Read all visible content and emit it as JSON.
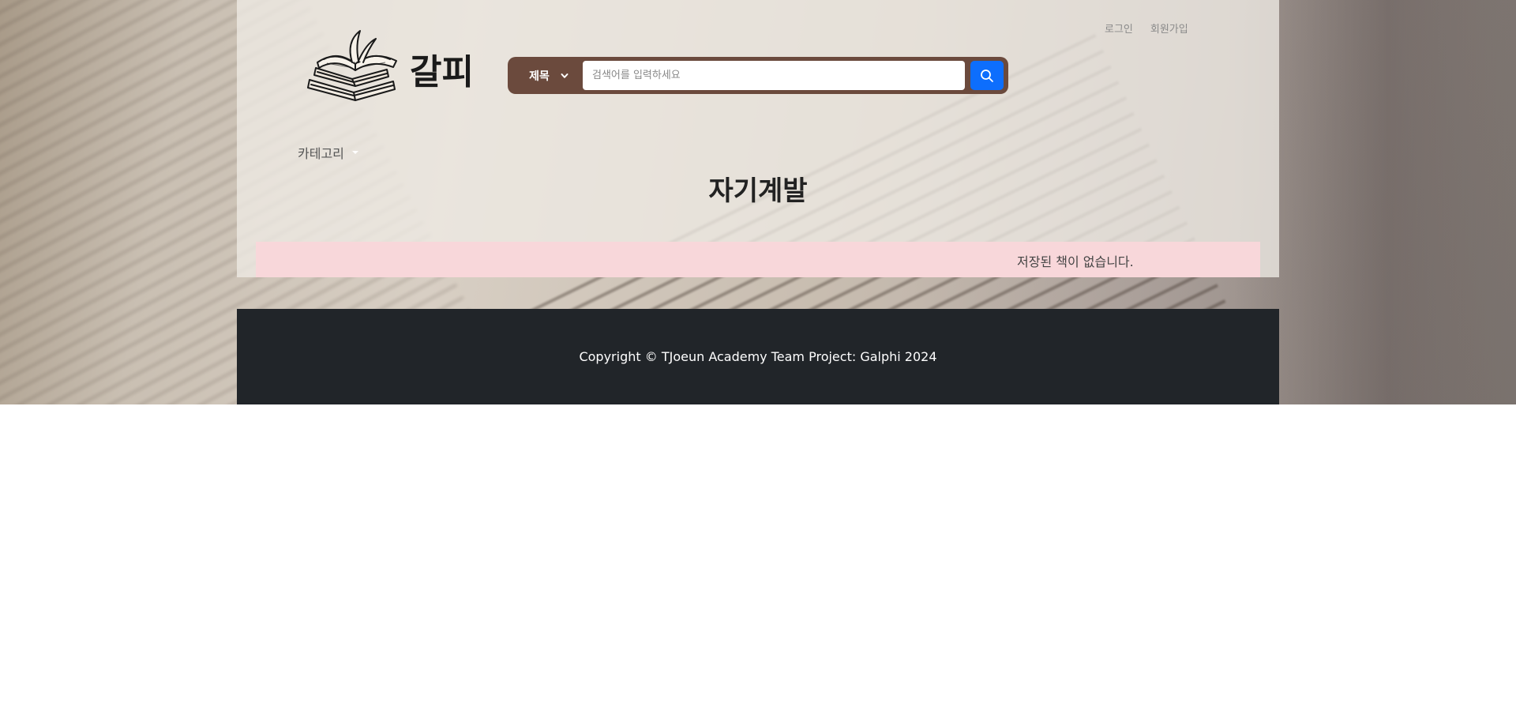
{
  "header": {
    "login_label": "로그인",
    "signup_label": "회원가입",
    "brand_name": "갈피",
    "logo_icon": "books-stack-open-book-icon"
  },
  "search": {
    "select_value": "제목",
    "placeholder": "검색어를 입력하세요",
    "button_icon": "search-icon"
  },
  "nav": {
    "category_label": "카테고리"
  },
  "main": {
    "page_title": "자기계발",
    "empty_message": "저장된 책이 없습니다."
  },
  "footer": {
    "copyright": "Copyright © TJoeun Academy Team Project: Galphi 2024"
  },
  "colors": {
    "search_bar": "#6b4a3d",
    "search_button": "#0d6efd",
    "alert_bg": "#f8d7da",
    "footer_bg": "#212529"
  }
}
